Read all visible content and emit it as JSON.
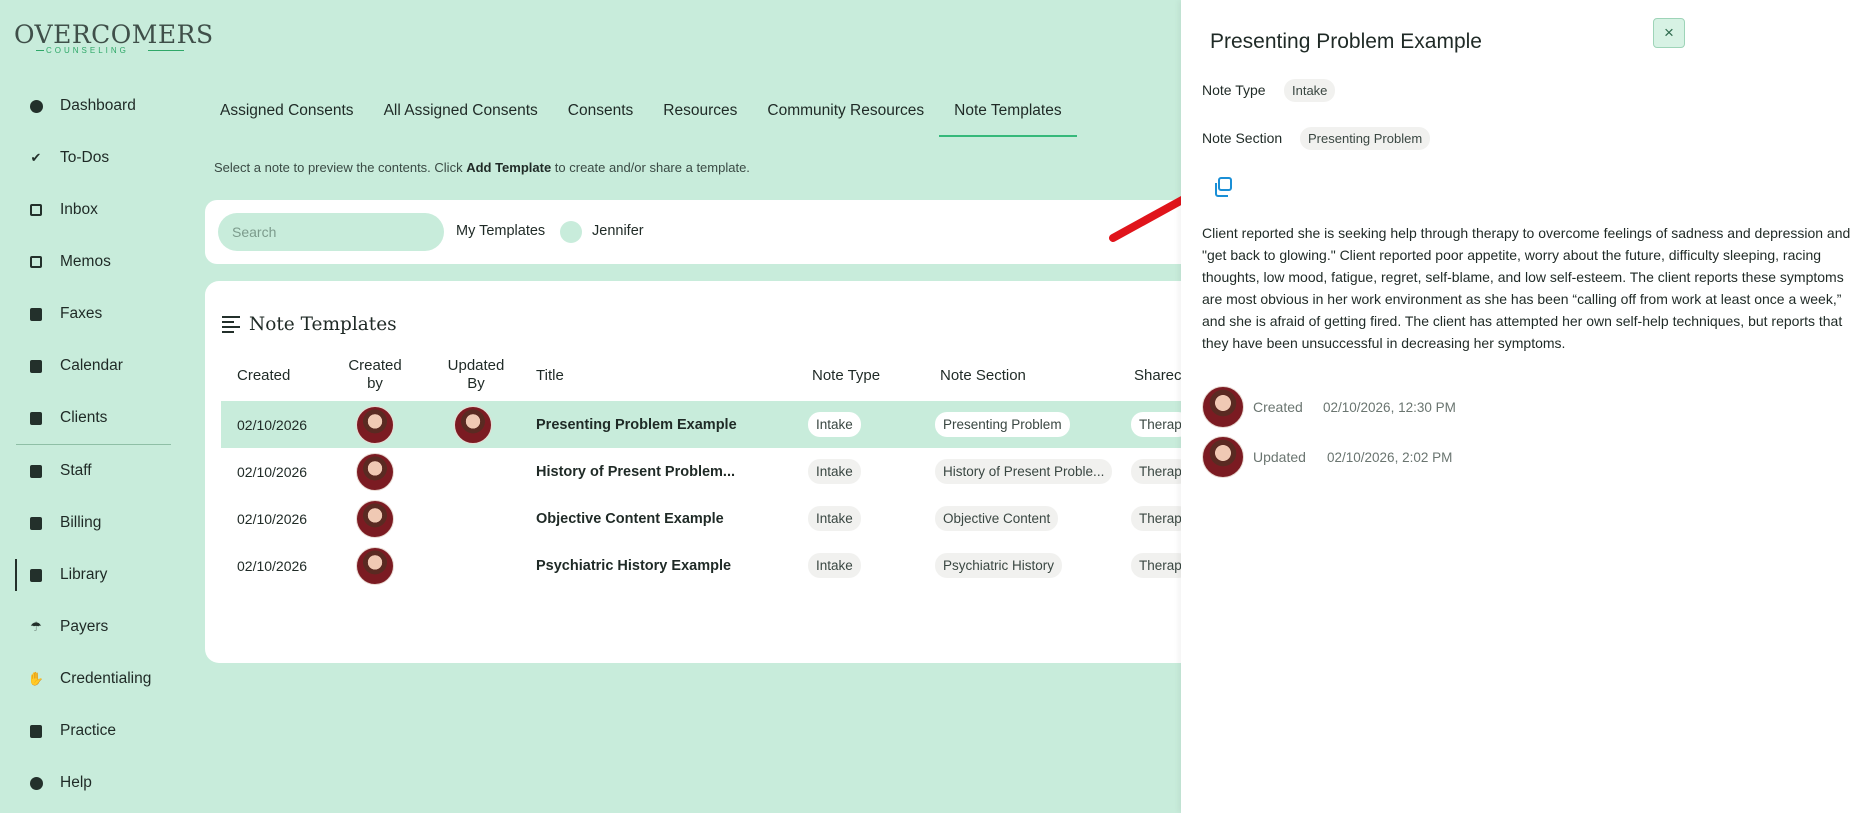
{
  "brand": {
    "name": "OVERCOMERS",
    "tagline": "COUNSELING"
  },
  "sidebar": {
    "items": [
      {
        "label": "Dashboard",
        "icon": "dashboard-icon"
      },
      {
        "label": "To-Dos",
        "icon": "checklist-icon"
      },
      {
        "label": "Inbox",
        "icon": "inbox-icon"
      },
      {
        "label": "Memos",
        "icon": "memo-icon"
      },
      {
        "label": "Faxes",
        "icon": "fax-icon"
      },
      {
        "label": "Calendar",
        "icon": "calendar-icon"
      },
      {
        "label": "Clients",
        "icon": "clients-icon"
      },
      {
        "label": "Staff",
        "icon": "staff-icon"
      },
      {
        "label": "Billing",
        "icon": "billing-icon"
      },
      {
        "label": "Library",
        "icon": "library-icon",
        "active": true
      },
      {
        "label": "Payers",
        "icon": "umbrella-icon"
      },
      {
        "label": "Credentialing",
        "icon": "handshake-icon"
      },
      {
        "label": "Practice",
        "icon": "building-icon"
      },
      {
        "label": "Help",
        "icon": "help-icon"
      }
    ]
  },
  "tabs": [
    "Assigned Consents",
    "All Assigned Consents",
    "Consents",
    "Resources",
    "Community Resources",
    "Note Templates"
  ],
  "active_tab": "Note Templates",
  "hint": {
    "prefix": "Select a note to preview the contents. Click ",
    "bold": "Add Template",
    "suffix": " to create and/or share a template."
  },
  "filters": {
    "search_placeholder": "Search",
    "my_templates_label": "My Templates",
    "user_name": "Jennifer"
  },
  "table": {
    "title": "Note Templates",
    "headers": {
      "created": "Created",
      "created_by_1": "Created",
      "created_by_2": "by",
      "updated_by_1": "Updated",
      "updated_by_2": "By",
      "title": "Title",
      "note_type": "Note Type",
      "note_section": "Note Section",
      "shared": "Sharec"
    },
    "rows": [
      {
        "created": "02/10/2026",
        "title": "Presenting Problem Example",
        "note_type": "Intake",
        "note_section": "Presenting Problem",
        "shared": "Therap",
        "has_updated_by": true,
        "selected": true
      },
      {
        "created": "02/10/2026",
        "title": "History of Present Problem...",
        "note_type": "Intake",
        "note_section": "History of Present Proble...",
        "shared": "Therap",
        "has_updated_by": false,
        "selected": false
      },
      {
        "created": "02/10/2026",
        "title": "Objective Content Example",
        "note_type": "Intake",
        "note_section": "Objective Content",
        "shared": "Therap",
        "has_updated_by": false,
        "selected": false
      },
      {
        "created": "02/10/2026",
        "title": "Psychiatric History Example",
        "note_type": "Intake",
        "note_section": "Psychiatric History",
        "shared": "Therap",
        "has_updated_by": false,
        "selected": false
      }
    ]
  },
  "drawer": {
    "title": "Presenting Problem Example",
    "close": "×",
    "note_type_label": "Note Type",
    "note_type_value": "Intake",
    "note_section_label": "Note Section",
    "note_section_value": "Presenting Problem",
    "body": "Client reported she is seeking help through therapy to overcome feelings of sadness and depression and \"get back to glowing.\" Client reported poor appetite, worry about the future, difficulty sleeping, racing thoughts, low mood, fatigue, regret, self-blame, and low self-esteem.  The client reports these symptoms are most obvious in her work environment as she has been “calling off from work at least once a week,” and she is afraid of getting fired.  The client has attempted her own self-help techniques, but reports that they have been unsuccessful in decreasing her symptoms.",
    "created_label": "Created",
    "created_value": "02/10/2026, 12:30 PM",
    "updated_label": "Updated",
    "updated_value": "02/10/2026, 2:02 PM"
  },
  "colors": {
    "accent": "#35b97a",
    "background": "#c8ecdb",
    "arrow": "#e0141b",
    "copy_icon": "#1a8fd6"
  }
}
